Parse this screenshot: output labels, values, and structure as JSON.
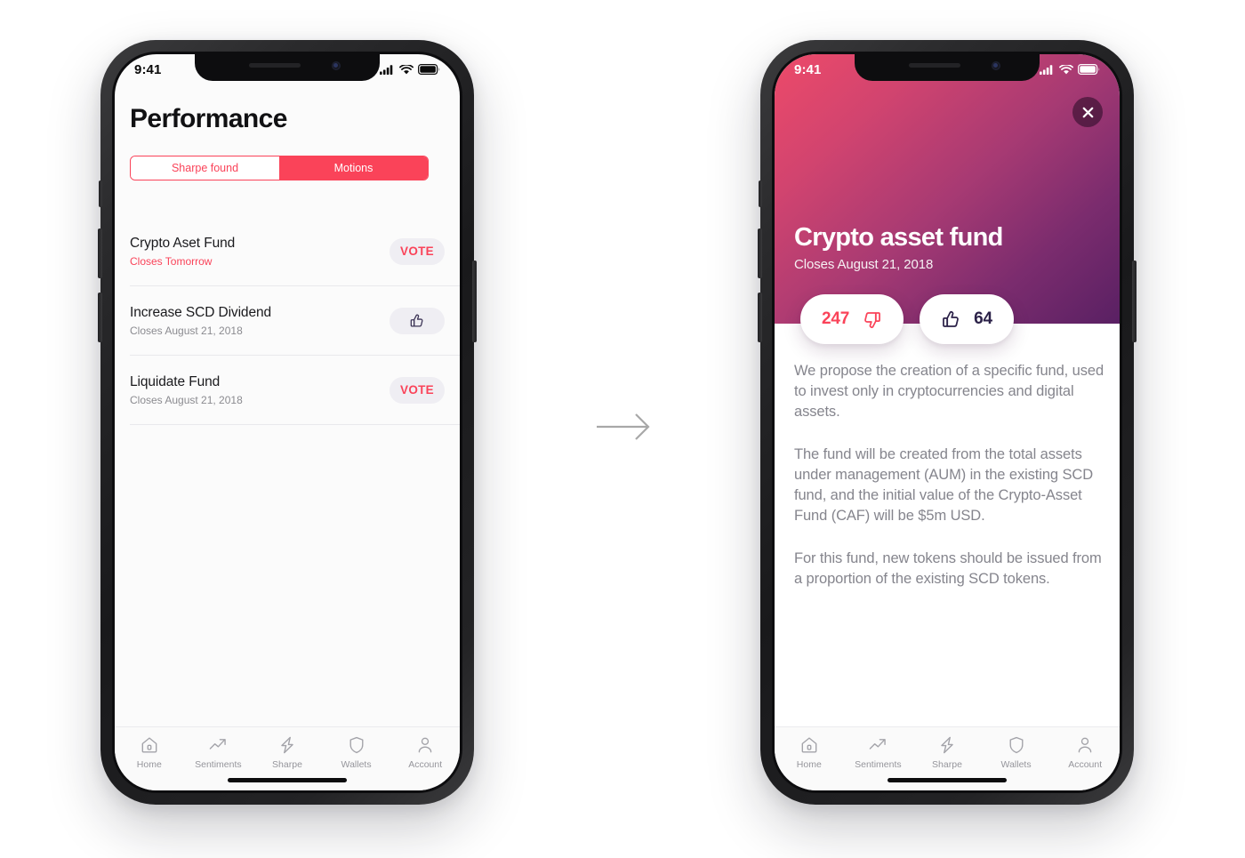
{
  "left_phone": {
    "status_bar": {
      "time": "9:41",
      "icons": [
        "signal-icon",
        "wifi-icon",
        "battery-icon"
      ]
    },
    "page_title": "Performance",
    "segmented_control": {
      "options": [
        {
          "label": "Sharpe found",
          "active": false
        },
        {
          "label": "Motions",
          "active": true
        }
      ]
    },
    "motions": [
      {
        "title": "Crypto Aset Fund",
        "subtitle": "Closes Tomorrow",
        "urgent": true,
        "action": "VOTE",
        "action_type": "vote"
      },
      {
        "title": "Increase SCD Dividend",
        "subtitle": "Closes August 21, 2018",
        "urgent": false,
        "action": "",
        "action_type": "thumbs-up"
      },
      {
        "title": "Liquidate Fund",
        "subtitle": "Closes August 21, 2018",
        "urgent": false,
        "action": "VOTE",
        "action_type": "vote"
      }
    ],
    "tabbar": [
      {
        "label": "Home",
        "icon": "home-icon"
      },
      {
        "label": "Sentiments",
        "icon": "trending-up-icon"
      },
      {
        "label": "Sharpe",
        "icon": "lightning-bolt-icon"
      },
      {
        "label": "Wallets",
        "icon": "shield-icon"
      },
      {
        "label": "Account",
        "icon": "person-icon"
      }
    ]
  },
  "right_phone": {
    "status_bar": {
      "time": "9:41",
      "icons": [
        "signal-icon",
        "wifi-icon",
        "battery-icon"
      ]
    },
    "close_label": "×",
    "hero": {
      "title": "Crypto asset fund",
      "subtitle": "Closes August 21, 2018"
    },
    "votes": {
      "downvotes": "247",
      "upvotes": "64"
    },
    "paragraphs": [
      "We propose the creation of a specific fund, used to invest only in cryptocurrencies and digital assets.",
      "The fund will be created from the total assets under management (AUM) in the existing SCD fund, and the initial value of the Crypto-Asset Fund (CAF) will be $5m USD.",
      "For this fund, new tokens should be issued from a proportion of the existing SCD tokens."
    ],
    "tabbar": [
      {
        "label": "Home",
        "icon": "home-icon"
      },
      {
        "label": "Sentiments",
        "icon": "trending-up-icon"
      },
      {
        "label": "Sharpe",
        "icon": "lightning-bolt-icon"
      },
      {
        "label": "Wallets",
        "icon": "shield-icon"
      },
      {
        "label": "Account",
        "icon": "person-icon"
      }
    ]
  },
  "flow": {
    "arrow": "right-arrow-icon"
  },
  "colors": {
    "accent_red": "#FA4359",
    "gradient_start": "#ED4A69",
    "gradient_end": "#592063",
    "dark_navy": "#2b2148",
    "muted_text": "#85858d",
    "pill_bg": "#efeef3"
  }
}
